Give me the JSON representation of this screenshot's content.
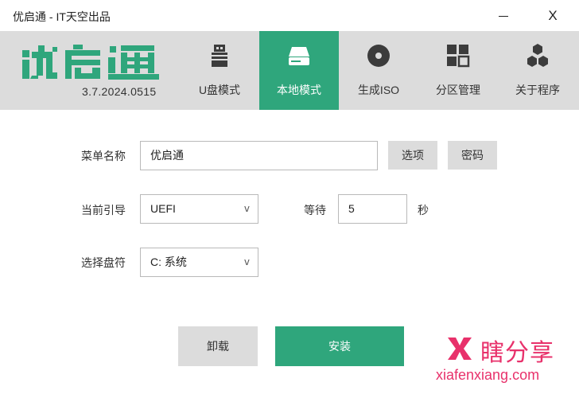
{
  "window": {
    "title": "优启通 - IT天空出品",
    "minimize_label": "",
    "close_label": "X"
  },
  "brand": {
    "logo_text": "优启通",
    "version": "3.7.2024.0515",
    "accent_color": "#2fa67c"
  },
  "tabs": [
    {
      "label": "U盘模式",
      "icon": "usb-drive-icon",
      "active": false
    },
    {
      "label": "本地模式",
      "icon": "hard-disk-icon",
      "active": true
    },
    {
      "label": "生成ISO",
      "icon": "disc-icon",
      "active": false
    },
    {
      "label": "分区管理",
      "icon": "grid-icon",
      "active": false
    },
    {
      "label": "关于程序",
      "icon": "hexagon-cluster-icon",
      "active": false
    }
  ],
  "form": {
    "menu_name": {
      "label": "菜单名称",
      "value": "优启通"
    },
    "options_button": "选项",
    "password_button": "密码",
    "boot": {
      "label": "当前引导",
      "value": "UEFI"
    },
    "wait": {
      "label": "等待",
      "value": "5",
      "unit": "秒"
    },
    "drive": {
      "label": "选择盘符",
      "value": "C: 系统"
    }
  },
  "actions": {
    "uninstall": "卸载",
    "install": "安装"
  },
  "watermark": {
    "brand": "瞎分享",
    "url": "xiafenxiang.com",
    "color": "#e8316b"
  }
}
